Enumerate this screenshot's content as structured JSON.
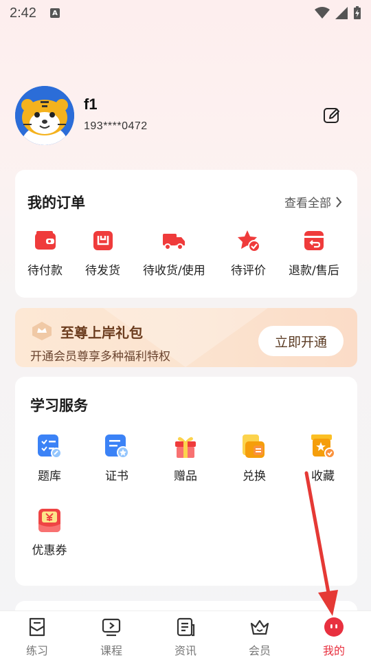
{
  "status_bar": {
    "time": "2:42",
    "notif_glyph": "A"
  },
  "profile": {
    "username": "f1",
    "phone": "193****0472"
  },
  "orders": {
    "title": "我的订单",
    "view_all": "查看全部",
    "items": [
      {
        "label": "待付款",
        "icon": "wallet-icon"
      },
      {
        "label": "待发货",
        "icon": "package-icon"
      },
      {
        "label": "待收货/使用",
        "icon": "truck-icon"
      },
      {
        "label": "待评价",
        "icon": "star-check-icon"
      },
      {
        "label": "退款/售后",
        "icon": "refund-icon"
      }
    ]
  },
  "vip": {
    "title": "至尊上岸礼包",
    "subtitle": "开通会员尊享多种福利特权",
    "button": "立即开通"
  },
  "study": {
    "title": "学习服务",
    "items": [
      {
        "label": "题库",
        "icon": "question-bank-icon"
      },
      {
        "label": "证书",
        "icon": "certificate-icon"
      },
      {
        "label": "赠品",
        "icon": "gift-icon"
      },
      {
        "label": "兑换",
        "icon": "exchange-icon"
      },
      {
        "label": "收藏",
        "icon": "favorites-icon"
      },
      {
        "label": "优惠券",
        "icon": "coupon-icon"
      }
    ]
  },
  "tabs": [
    {
      "label": "练习",
      "icon": "practice-icon",
      "active": false
    },
    {
      "label": "课程",
      "icon": "course-icon",
      "active": false
    },
    {
      "label": "资讯",
      "icon": "news-icon",
      "active": false
    },
    {
      "label": "会员",
      "icon": "crown-icon",
      "active": false
    },
    {
      "label": "我的",
      "icon": "profile-face-icon",
      "active": true
    }
  ],
  "colors": {
    "accent_red": "#e8303f",
    "icon_red": "#ef3b3b",
    "vip_brown": "#6b3c1e",
    "annotation_arrow": "#e53935"
  }
}
